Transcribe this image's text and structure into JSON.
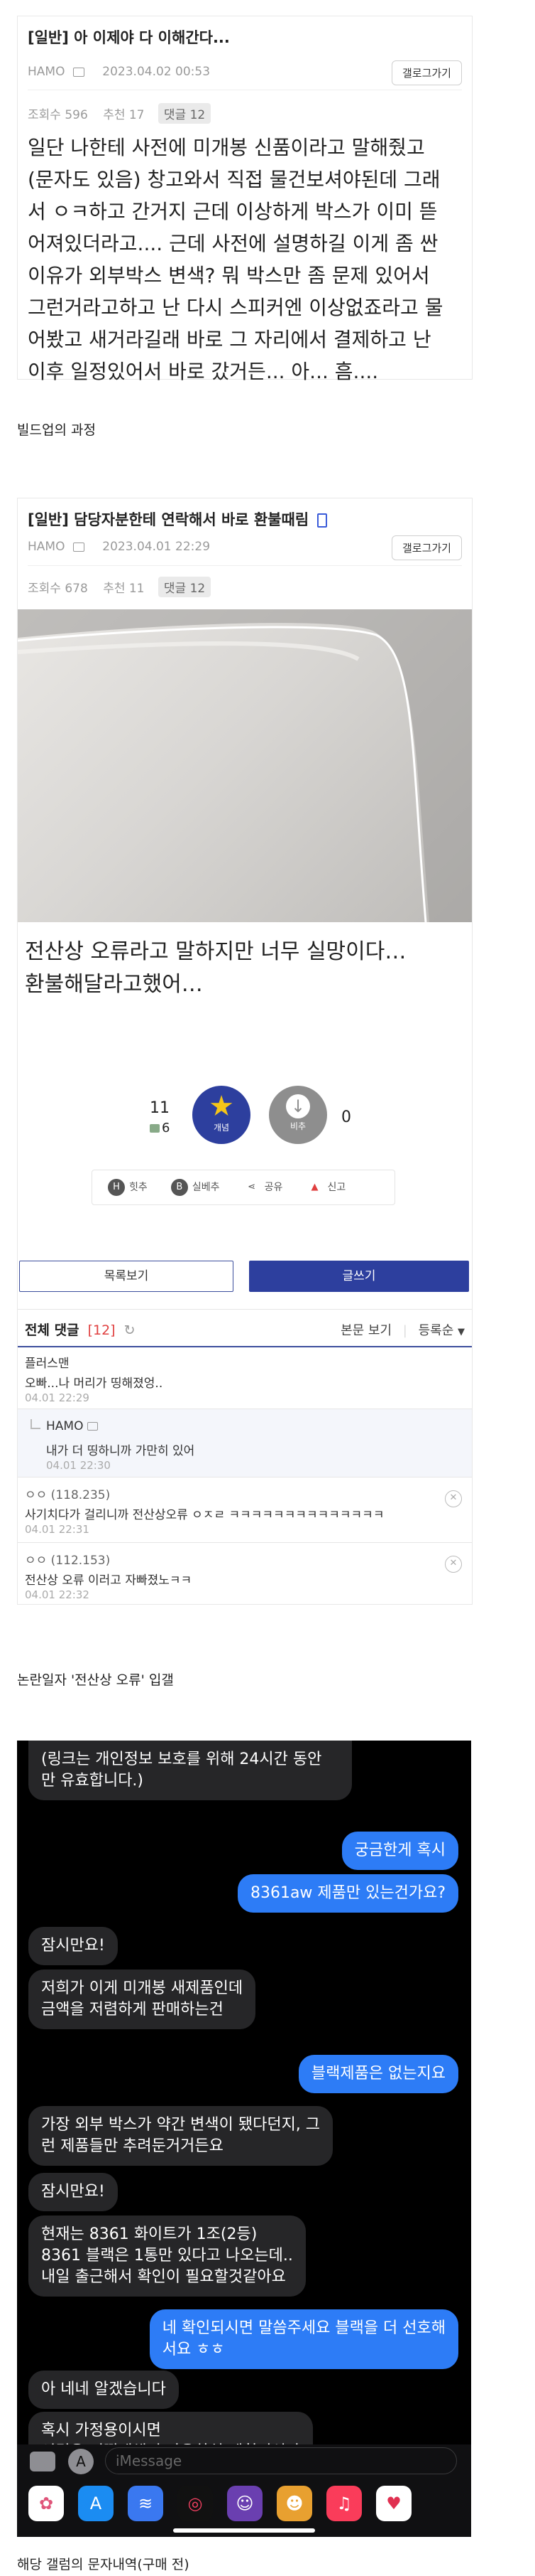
{
  "post1": {
    "title": "[일반] 아 이제야 다 이해간다...",
    "author": "HAMO",
    "datetime": "2023.04.02 00:53",
    "views": "조회수 596",
    "recommends": "추천 17",
    "replies": "댓글 12",
    "gallery_button": "갤로그가기",
    "body_lines": [
      "일단 나한테 사전에 미개봉 신품이라고 말해줬고",
      "(문자도 있음) 창고와서 직접 물건보셔야된데 그래",
      "서 ㅇㅋ하고 간거지 근데 이상하게 박스가 이미 뜯",
      "어져있더라고.... 근데 사전에 설명하길 이게 좀 싼",
      "이유가 외부박스 변색? 뭐 박스만 좀 문제 있어서",
      "그런거라고하고 난 다시 스피커엔 이상없죠라고 물",
      "어봤고 새거라길래 바로 그 자리에서 결제하고 난",
      "이후 일정있어서 바로 갔거든... 아... 흠...."
    ]
  },
  "caption1": "빌드업의 과정",
  "post2": {
    "title": "[일반] 담당자분한테 연락해서 바로 환불때림",
    "author": "HAMO",
    "datetime": "2023.04.01 22:29",
    "views": "조회수 678",
    "recommends": "추천 11",
    "replies": "댓글 12",
    "gallery_button": "갤로그가기",
    "body_lines": [
      "전산상 오류라고 말하지만 너무 실망이다…",
      "환불해달라고했어…"
    ],
    "up_count": "11",
    "sub_count": "6",
    "down_count": "0",
    "up_label": "개념",
    "down_label": "비추",
    "actions": [
      "힛추",
      "실베추",
      "공유",
      "신고"
    ],
    "list_button": "목록보기",
    "write_button": "글쓰기",
    "comments_header": "전체 댓글",
    "comments_count": "[12]",
    "view_original": "본문 보기",
    "sort_label": "등록순",
    "comments": [
      {
        "author": "플러스맨",
        "text": "오빠...나 머리가 띵해졌엉..",
        "date": "04.01 22:29",
        "reply": false,
        "closable": false
      },
      {
        "author": "HAMO",
        "text": "내가 더 띵하니까 가만히 있어",
        "date": "04.01 22:30",
        "reply": true,
        "closable": false
      },
      {
        "author": "ㅇㅇ (118.235)",
        "text": "사기치다가 걸리니까 전산상오류 ㅇㅈㄹ ㅋㅋㅋㅋㅋㅋㅋㅋㅋㅋㅋㅋㅋㅋ",
        "date": "04.01 22:31",
        "reply": false,
        "closable": true
      },
      {
        "author": "ㅇㅇ (112.153)",
        "text": "전산상 오류 이러고 자빠졌노ㅋㅋ",
        "date": "04.01 22:32",
        "reply": false,
        "closable": true
      }
    ]
  },
  "caption2": "논란일자 '전산상 오류' 입갤",
  "sms": {
    "messages": [
      {
        "dir": "in",
        "text": "(링크는 개인정보 보호를 위해 24시간 동안\n만 유효합니다.)"
      },
      {
        "dir": "out",
        "text": "궁금한게 혹시"
      },
      {
        "dir": "out",
        "text": "8361aw 제품만 있는건가요?"
      },
      {
        "dir": "in",
        "text": "잠시만요!"
      },
      {
        "dir": "in",
        "text": "저희가 이게 미개봉 새제품인데\n금액을 저렴하게 판매하는건"
      },
      {
        "dir": "out",
        "text": "블랙제품은 없는지요"
      },
      {
        "dir": "in",
        "text": "가장 외부 박스가 약간 변색이 됐다던지, 그\n런 제품들만 추려둔거거든요"
      },
      {
        "dir": "in",
        "text": "잠시만요!"
      },
      {
        "dir": "in",
        "text": "현재는 8361 화이트가 1조(2등)\n8361 블랙은 1통만 있다고 나오는데..\n내일 출근해서 확인이 필요할것같아요"
      },
      {
        "dir": "out",
        "text": "네 확인되시면 말씀주세요 블랙을 더 선호해\n서요 ㅎㅎ"
      },
      {
        "dir": "in",
        "text": "아 네네 알겠습니다"
      },
      {
        "dir": "in",
        "text": "혹시 가정용이시면\n연결은 어떻게해서 사용하실 계획이신가\n요?!"
      }
    ],
    "input_placeholder": "iMessage"
  },
  "caption3": "해당 갤럼의 문자내역(구매 전)",
  "colors": {
    "accent": "#2d3f9e",
    "star": "#f5c518",
    "imessage_blue": "#2d7cf6",
    "incoming": "#262628"
  }
}
